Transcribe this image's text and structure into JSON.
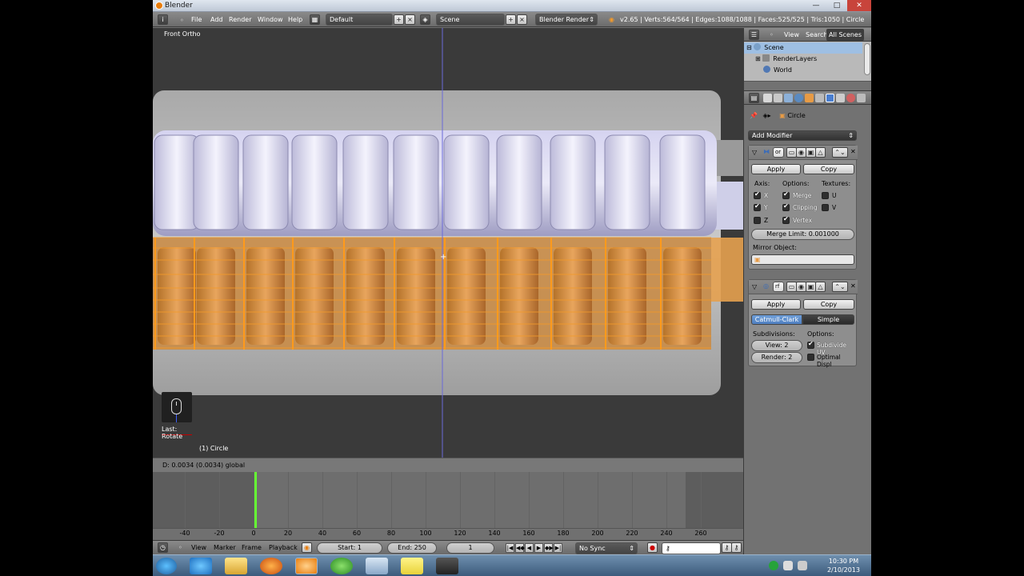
{
  "window": {
    "title": "Blender"
  },
  "info_header": {
    "menus": [
      "File",
      "Add",
      "Render",
      "Window",
      "Help"
    ],
    "screen_layout": "Default",
    "scene": "Scene",
    "render_engine": "Blender Render",
    "stats": "v2.65 | Verts:564/564 | Edges:1088/1088 | Faces:525/525 | Tris:1050 | Circle"
  },
  "viewport": {
    "view_label": "Front Ortho",
    "last_operator": "Last: Rotate",
    "object_label": "(1) Circle"
  },
  "status": {
    "text": "D: 0.0034 (0.0034) global"
  },
  "timeline": {
    "ruler_ticks": [
      "-40",
      "-20",
      "0",
      "20",
      "40",
      "60",
      "80",
      "100",
      "120",
      "140",
      "160",
      "180",
      "200",
      "220",
      "240",
      "260"
    ],
    "current_frame_value": 1,
    "menus": [
      "View",
      "Marker",
      "Frame",
      "Playback"
    ],
    "start_field": "Start: 1",
    "end_field": "End: 250",
    "current_frame": "1",
    "sync": "No Sync"
  },
  "outliner": {
    "header_items": [
      "View",
      "Search",
      "All Scenes"
    ],
    "rows": [
      "Scene",
      "RenderLayers",
      "World"
    ]
  },
  "properties": {
    "breadcrumb_object": "Circle",
    "add_modifier": "Add Modifier",
    "mirror": {
      "name_abbr": "or",
      "apply": "Apply",
      "copy": "Copy",
      "axis_label": "Axis:",
      "options_label": "Options:",
      "textures_label": "Textures:",
      "axes": [
        {
          "label": "X",
          "checked": true
        },
        {
          "label": "Y",
          "checked": true
        },
        {
          "label": "Z",
          "checked": false
        }
      ],
      "options": [
        {
          "label": "Merge",
          "checked": true
        },
        {
          "label": "Clipping",
          "checked": true
        },
        {
          "label": "Vertex",
          "checked": true
        }
      ],
      "textures": [
        {
          "label": "U",
          "checked": false
        },
        {
          "label": "V",
          "checked": false
        }
      ],
      "merge_limit": "Merge Limit: 0.001000",
      "mirror_object_label": "Mirror Object:"
    },
    "subsurf": {
      "name_abbr": "rf",
      "apply": "Apply",
      "copy": "Copy",
      "catmull": "Catmull-Clark",
      "simple": "Simple",
      "subdivisions_label": "Subdivisions:",
      "options_label": "Options:",
      "view": "View: 2",
      "render": "Render: 2",
      "subdivide_uv": "Subdivide UV",
      "optimal_display": "Optimal Displ"
    }
  },
  "taskbar": {
    "time": "10:30 PM",
    "date": "2/10/2013"
  },
  "colors": {
    "accent_orange": "#f39a2a",
    "selection_blue": "#5680c2",
    "frame_cursor_green": "#66ff33"
  }
}
